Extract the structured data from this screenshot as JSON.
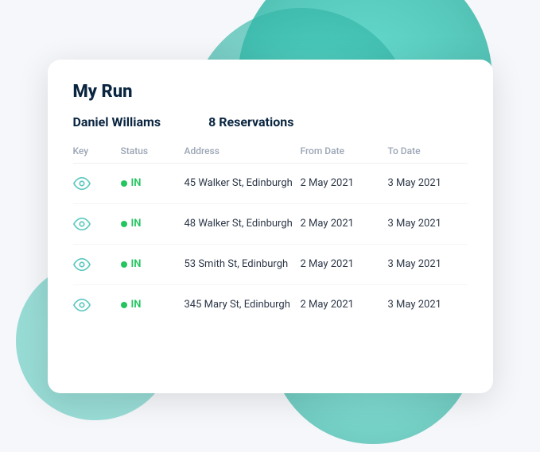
{
  "background": {
    "circles": [
      "large",
      "medium",
      "bottom",
      "left"
    ]
  },
  "card": {
    "title": "My Run",
    "user_name": "Daniel Williams",
    "reservations_count": "8 Reservations",
    "table": {
      "headers": [
        "Key",
        "Status",
        "Address",
        "From Date",
        "To Date"
      ],
      "rows": [
        {
          "status_dot": "green",
          "status_label": "IN",
          "address": "45 Walker St, Edinburgh",
          "from_date": "2 May 2021",
          "to_date": "3 May 2021"
        },
        {
          "status_dot": "green",
          "status_label": "IN",
          "address": "48 Walker St, Edinburgh",
          "from_date": "2 May 2021",
          "to_date": "3 May 2021"
        },
        {
          "status_dot": "green",
          "status_label": "IN",
          "address": "53 Smith St, Edinburgh",
          "from_date": "2 May 2021",
          "to_date": "3 May 2021"
        },
        {
          "status_dot": "green",
          "status_label": "IN",
          "address": "345 Mary St, Edinburgh",
          "from_date": "2 May 2021",
          "to_date": "3 May 2021"
        }
      ]
    }
  }
}
